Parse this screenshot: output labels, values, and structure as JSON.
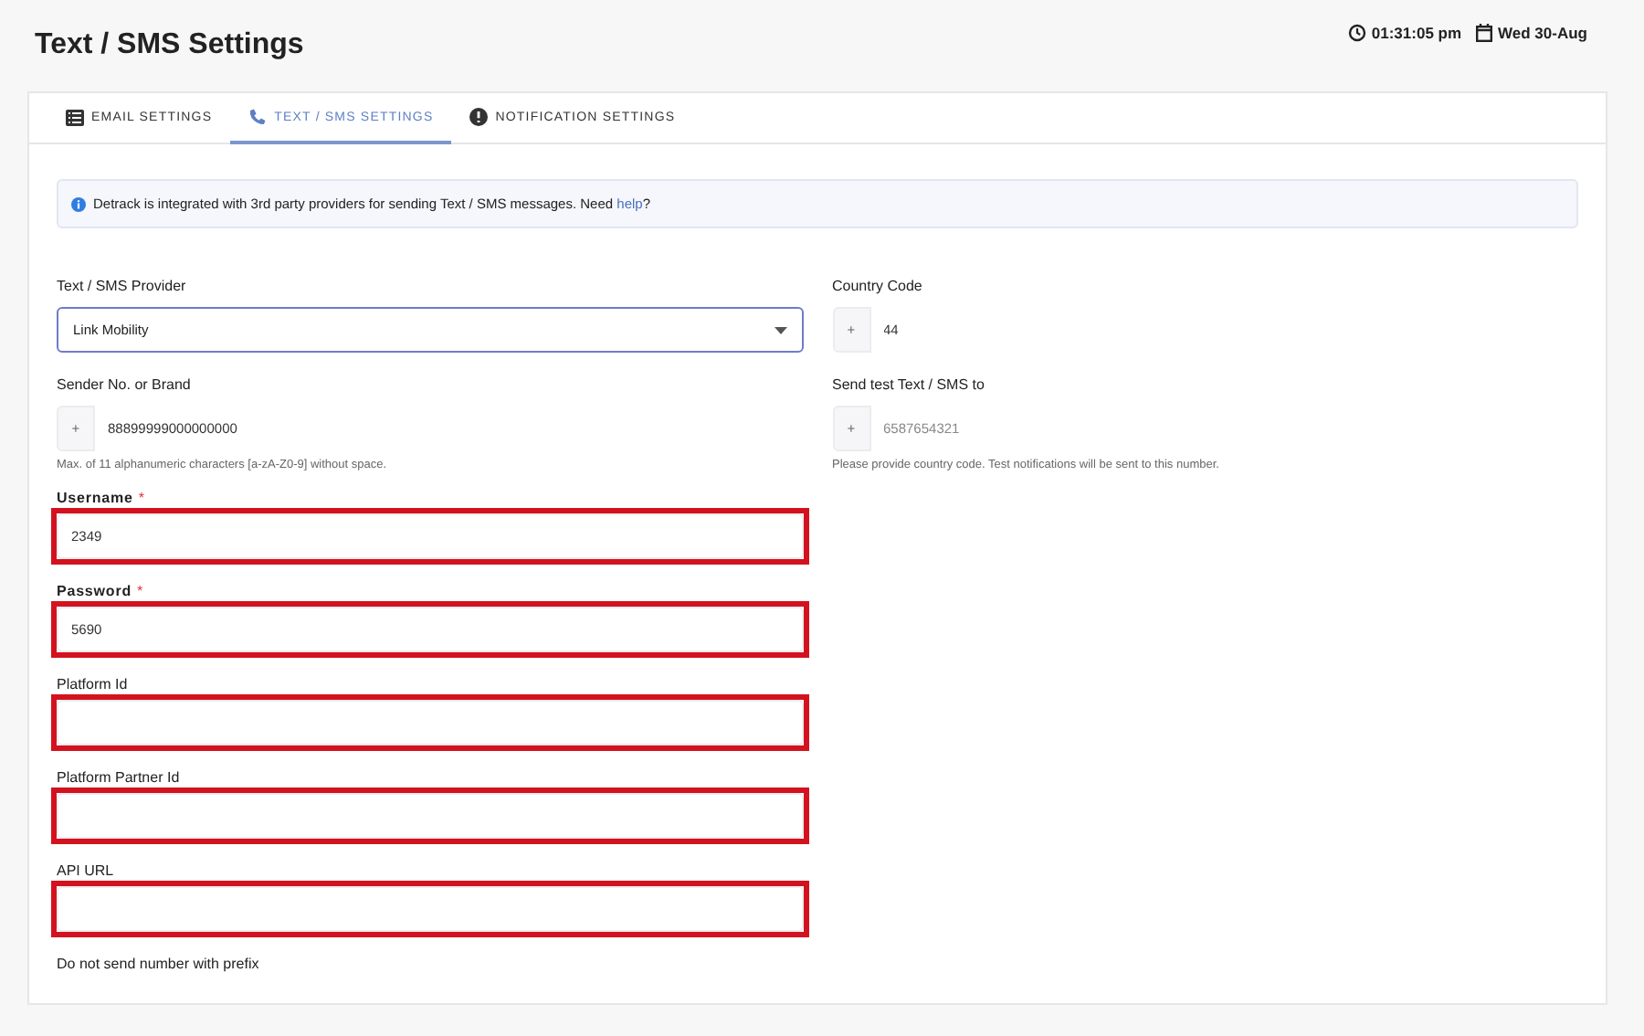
{
  "page": {
    "title": "Text / SMS Settings",
    "time": "01:31:05 pm",
    "date": "Wed 30-Aug"
  },
  "tabs": [
    {
      "label": "EMAIL SETTINGS",
      "selected": false
    },
    {
      "label": "TEXT / SMS SETTINGS",
      "selected": true
    },
    {
      "label": "NOTIFICATION SETTINGS",
      "selected": false
    }
  ],
  "info": {
    "text": "Detrack is integrated with 3rd party providers for sending Text / SMS messages. Need ",
    "link": "help",
    "after": "?"
  },
  "required_mark": "*",
  "left_fields": [
    {
      "kind": "select",
      "label": "Text / SMS Provider",
      "value": "Link Mobility",
      "required": false,
      "highlighted": false
    },
    {
      "kind": "prefix",
      "label": "Sender No. or Brand",
      "prefix": "+",
      "value": "88899999000000000",
      "hint": "Max. of 11 alphanumeric characters [a-zA-Z0-9] without space.",
      "required": false,
      "highlighted": false
    },
    {
      "kind": "text",
      "label": "Username",
      "value": "2349",
      "required": true,
      "highlighted": true
    },
    {
      "kind": "text",
      "label": "Password",
      "value": "5690",
      "required": true,
      "highlighted": true
    },
    {
      "kind": "text",
      "label": "Platform Id",
      "required": false,
      "highlighted": true
    },
    {
      "kind": "text",
      "label": "Platform Partner Id",
      "required": false,
      "highlighted": true
    },
    {
      "kind": "text",
      "label": "API URL",
      "required": false,
      "highlighted": true
    },
    {
      "kind": "label",
      "label": "Do not send number with prefix",
      "required": false,
      "highlighted": false
    }
  ],
  "right_fields": [
    {
      "kind": "prefix",
      "label": "Country Code",
      "prefix": "+",
      "value": "44",
      "required": false,
      "highlighted": false
    },
    {
      "kind": "prefix",
      "label": "Send test Text / SMS to",
      "prefix": "+",
      "placeholder": "6587654321",
      "hint": "Please provide country code. Test notifications will be sent to this number.",
      "required": false,
      "highlighted": false
    }
  ]
}
